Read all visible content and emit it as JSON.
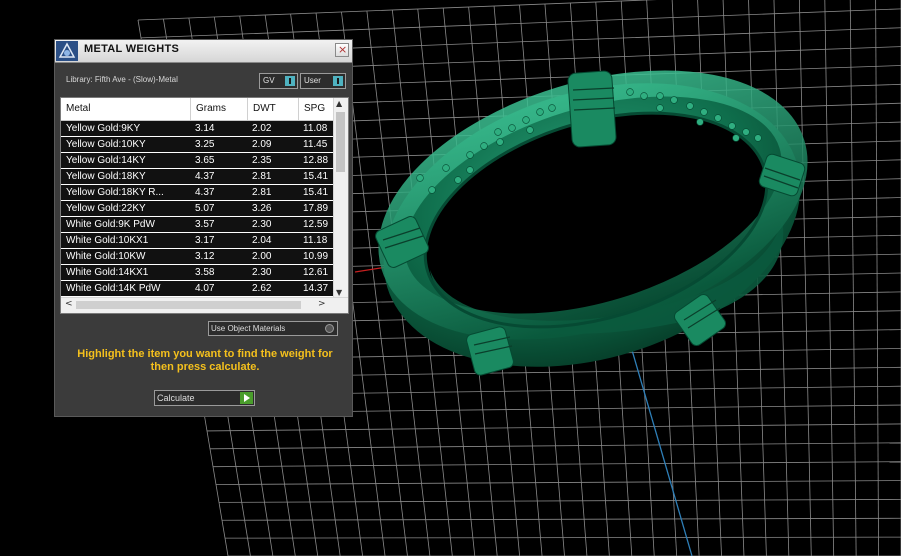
{
  "panel": {
    "title": "METAL WEIGHTS",
    "close_label": "×",
    "library_label": "Library: Fifth Ave - (Slow)-Metal",
    "toggles": [
      {
        "label": "GV"
      },
      {
        "label": "User"
      }
    ],
    "table": {
      "columns": [
        "Metal",
        "Grams",
        "DWT",
        "SPG"
      ],
      "rows": [
        [
          "Yellow Gold:9KY",
          "3.14",
          "2.02",
          "11.08"
        ],
        [
          "Yellow Gold:10KY",
          "3.25",
          "2.09",
          "11.45"
        ],
        [
          "Yellow Gold:14KY",
          "3.65",
          "2.35",
          "12.88"
        ],
        [
          "Yellow Gold:18KY",
          "4.37",
          "2.81",
          "15.41"
        ],
        [
          "Yellow Gold:18KY R...",
          "4.37",
          "2.81",
          "15.41"
        ],
        [
          "Yellow Gold:22KY",
          "5.07",
          "3.26",
          "17.89"
        ],
        [
          "White Gold:9K PdW",
          "3.57",
          "2.30",
          "12.59"
        ],
        [
          "White Gold:10KX1",
          "3.17",
          "2.04",
          "11.18"
        ],
        [
          "White Gold:10KW",
          "3.12",
          "2.00",
          "10.99"
        ],
        [
          "White Gold:14KX1",
          "3.58",
          "2.30",
          "12.61"
        ],
        [
          "White Gold:14K PdW",
          "4.07",
          "2.62",
          "14.37"
        ]
      ],
      "scroll_up": "▲",
      "scroll_down": "▼",
      "scroll_left": "<",
      "scroll_right": ">"
    },
    "use_object_materials_label": "Use Object Materials",
    "instruction": "Highlight the item you want to find the weight for then press calculate.",
    "calculate_label": "Calculate"
  },
  "colors": {
    "ring": "#0f6e4c",
    "grid": "#8a8a8a",
    "instruction": "#f4c01d",
    "accent": "#4fb2c0"
  }
}
